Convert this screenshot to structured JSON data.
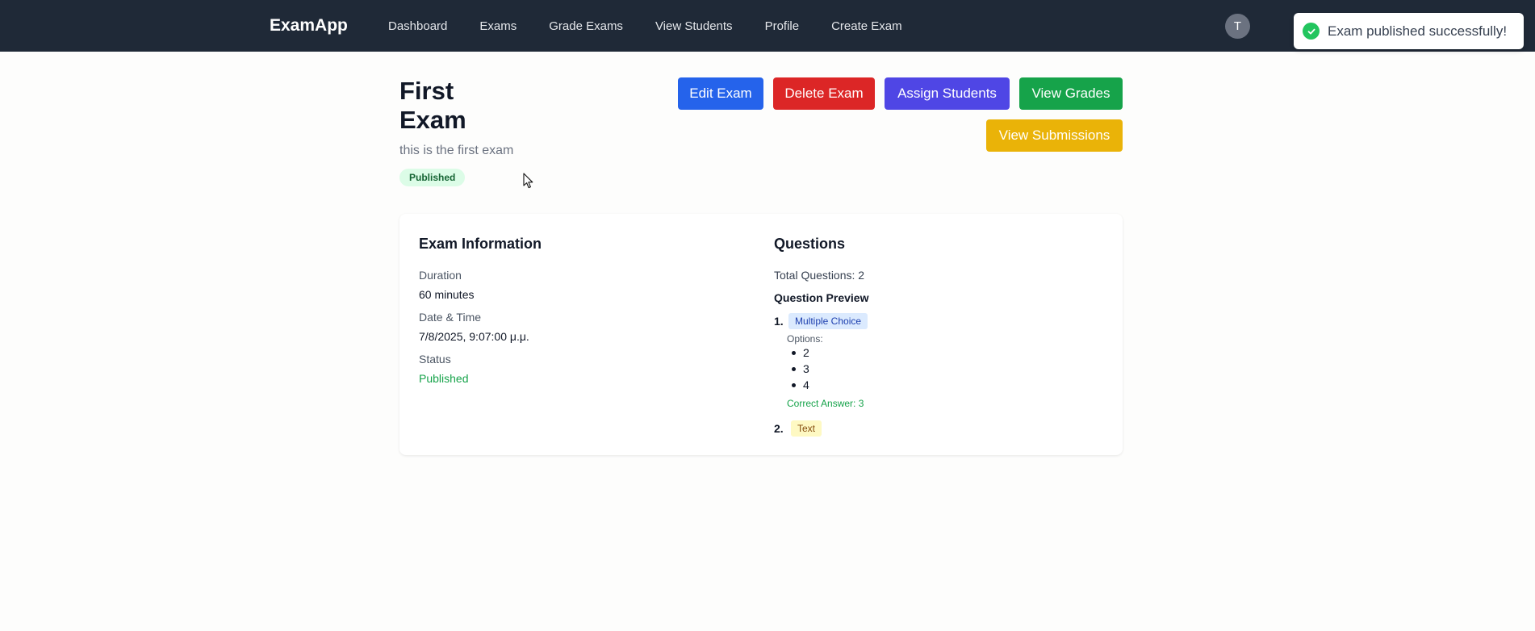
{
  "nav": {
    "brand": "ExamApp",
    "links": [
      "Dashboard",
      "Exams",
      "Grade Exams",
      "View Students",
      "Profile",
      "Create Exam"
    ],
    "avatar_initial": "T"
  },
  "toast": {
    "message": "Exam published successfully!",
    "icon": "check-circle-icon",
    "color": "#22c55e"
  },
  "exam": {
    "title": "First Exam",
    "description": "this is the first exam",
    "status_badge": "Published"
  },
  "actions": {
    "edit": "Edit Exam",
    "delete": "Delete Exam",
    "assign": "Assign Students",
    "grades": "View Grades",
    "submissions": "View Submissions"
  },
  "info": {
    "heading": "Exam Information",
    "duration_label": "Duration",
    "duration_value": "60 minutes",
    "datetime_label": "Date & Time",
    "datetime_value": "7/8/2025, 9:07:00 μ.μ.",
    "status_label": "Status",
    "status_value": "Published"
  },
  "questions": {
    "heading": "Questions",
    "total": "Total Questions: 2",
    "preview_heading": "Question Preview",
    "items": [
      {
        "number": "1.",
        "type": "Multiple Choice",
        "options_label": "Options:",
        "options": [
          "2",
          "3",
          "4"
        ],
        "correct": "Correct Answer: 3"
      },
      {
        "number": "2.",
        "type": "Text"
      }
    ]
  },
  "colors": {
    "navbar": "#1f2937",
    "edit": "#2563eb",
    "delete": "#dc2626",
    "assign": "#4f46e5",
    "grades": "#16a34a",
    "submissions": "#eab308"
  }
}
